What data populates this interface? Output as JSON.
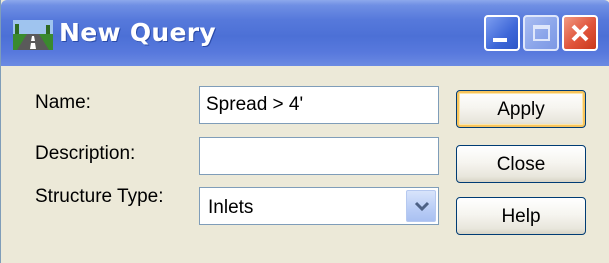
{
  "window": {
    "title": "New Query",
    "controls": {
      "minimize": "minimize-icon",
      "maximize": "maximize-icon",
      "close": "close-icon"
    },
    "icon": "road-app-icon"
  },
  "form": {
    "name_label": "Name:",
    "name_value": "Spread > 4'",
    "description_label": "Description:",
    "description_value": "",
    "structure_type_label": "Structure Type:",
    "structure_type_value": "Inlets"
  },
  "buttons": {
    "apply": "Apply",
    "close": "Close",
    "help": "Help"
  },
  "colors": {
    "titlebar": "#4c70d6",
    "dialog_bg": "#ece9d8",
    "default_button_highlight": "#f7c45c",
    "close_button": "#e0543a"
  }
}
